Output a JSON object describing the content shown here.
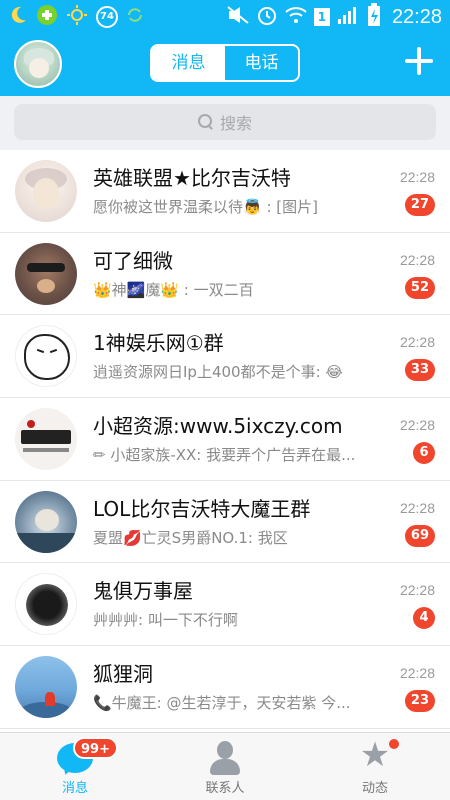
{
  "status_bar": {
    "left_icons": [
      "moon-icon",
      "app-icon",
      "sun-icon",
      "notification-74-icon",
      "recycle-icon"
    ],
    "notification_count": "74",
    "right_icons": [
      "mute-icon",
      "alarm-icon",
      "wifi-icon",
      "sim-icon",
      "signal-icon",
      "battery-charging-icon"
    ],
    "sim_label": "1",
    "time": "22:28"
  },
  "header": {
    "tabs": [
      {
        "label": "消息",
        "active": true
      },
      {
        "label": "电话",
        "active": false
      }
    ],
    "add_label": "+"
  },
  "search": {
    "placeholder": "搜索"
  },
  "conversations": [
    {
      "name": "英雄联盟★比尔吉沃特",
      "preview": "愿你被这世界温柔以待👼 : [图片]",
      "time": "22:28",
      "unread": "27"
    },
    {
      "name": "可了细微",
      "preview": "👑神🌌魔👑 : 一双二百",
      "time": "22:28",
      "unread": "52"
    },
    {
      "name": "1神娱乐网①群",
      "preview": "逍遥资源网日Ip上400都不是个事: 😂",
      "time": "22:28",
      "unread": "33"
    },
    {
      "name": "小超资源:www.5ixczy.com",
      "preview": "✏ 小超家族-XX: 我要弄个广告弄在最...",
      "time": "22:28",
      "unread": "6"
    },
    {
      "name": "LOL比尔吉沃特大魔王群",
      "preview": "夏盟💋亡灵S男爵NO.1: 我区",
      "time": "22:28",
      "unread": "69"
    },
    {
      "name": "鬼俱万事屋",
      "preview": "艸艸艸: 叫一下不行啊",
      "time": "22:28",
      "unread": "4"
    },
    {
      "name": "狐狸洞",
      "preview": "📞牛魔王: @生若淳于，天安若紫 今...",
      "time": "22:28",
      "unread": "23"
    }
  ],
  "bottom_nav": {
    "items": [
      {
        "label": "消息",
        "active": true,
        "badge": "99+"
      },
      {
        "label": "联系人",
        "active": false
      },
      {
        "label": "动态",
        "active": false
      }
    ]
  },
  "colors": {
    "accent": "#12b7f5",
    "badge": "#f0462e"
  }
}
